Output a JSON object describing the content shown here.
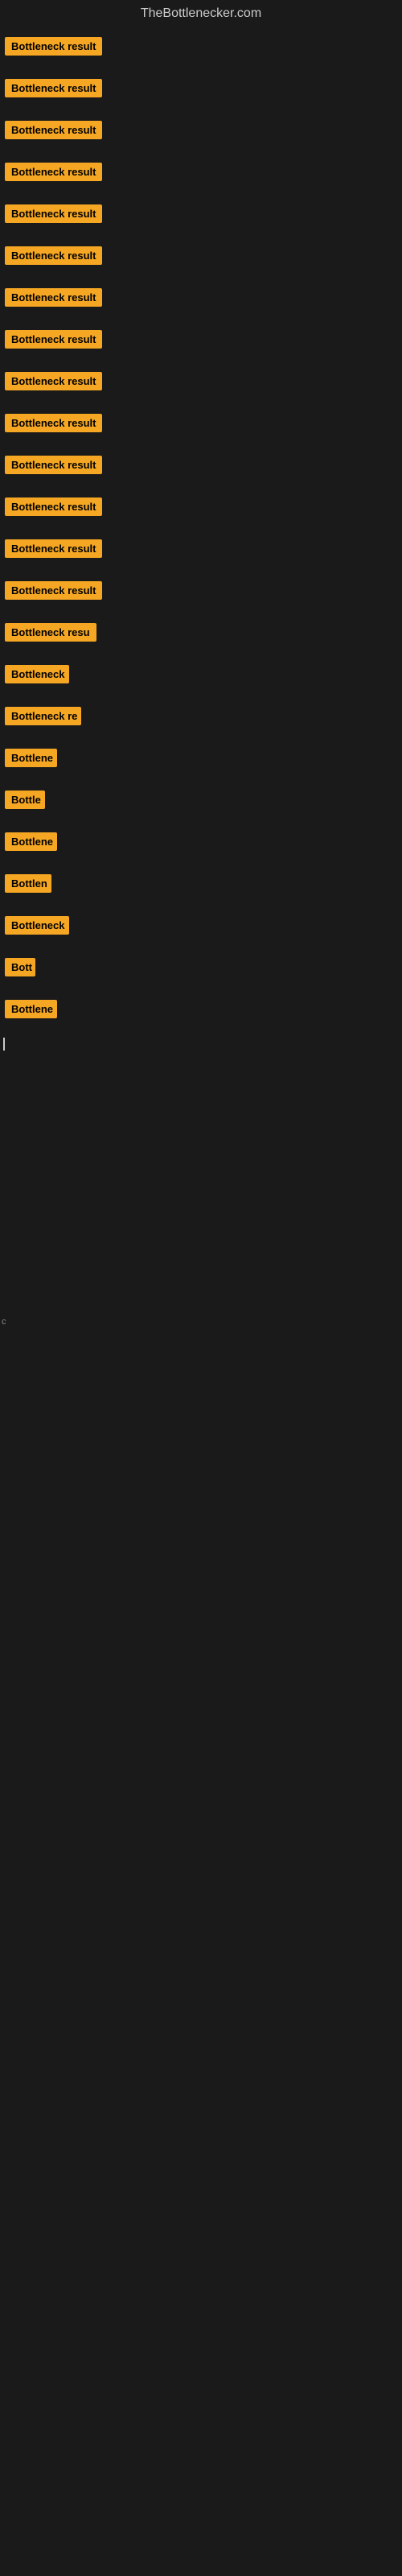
{
  "site": {
    "title": "TheBottlenecker.com"
  },
  "rows": [
    {
      "label": "Bottleneck result",
      "width": 140
    },
    {
      "label": "Bottleneck result",
      "width": 140
    },
    {
      "label": "Bottleneck result",
      "width": 140
    },
    {
      "label": "Bottleneck result",
      "width": 140
    },
    {
      "label": "Bottleneck result",
      "width": 140
    },
    {
      "label": "Bottleneck result",
      "width": 140
    },
    {
      "label": "Bottleneck result",
      "width": 140
    },
    {
      "label": "Bottleneck result",
      "width": 140
    },
    {
      "label": "Bottleneck result",
      "width": 140
    },
    {
      "label": "Bottleneck result",
      "width": 140
    },
    {
      "label": "Bottleneck result",
      "width": 140
    },
    {
      "label": "Bottleneck result",
      "width": 140
    },
    {
      "label": "Bottleneck result",
      "width": 140
    },
    {
      "label": "Bottleneck result",
      "width": 140
    },
    {
      "label": "Bottleneck resu",
      "width": 120
    },
    {
      "label": "Bottleneck",
      "width": 80
    },
    {
      "label": "Bottleneck re",
      "width": 95
    },
    {
      "label": "Bottlene",
      "width": 65
    },
    {
      "label": "Bottle",
      "width": 50
    },
    {
      "label": "Bottlene",
      "width": 65
    },
    {
      "label": "Bottlen",
      "width": 58
    },
    {
      "label": "Bottleneck",
      "width": 80
    },
    {
      "label": "Bott",
      "width": 38
    },
    {
      "label": "Bottlene",
      "width": 65
    }
  ],
  "cursor_row": 24,
  "bottom_label": "c"
}
